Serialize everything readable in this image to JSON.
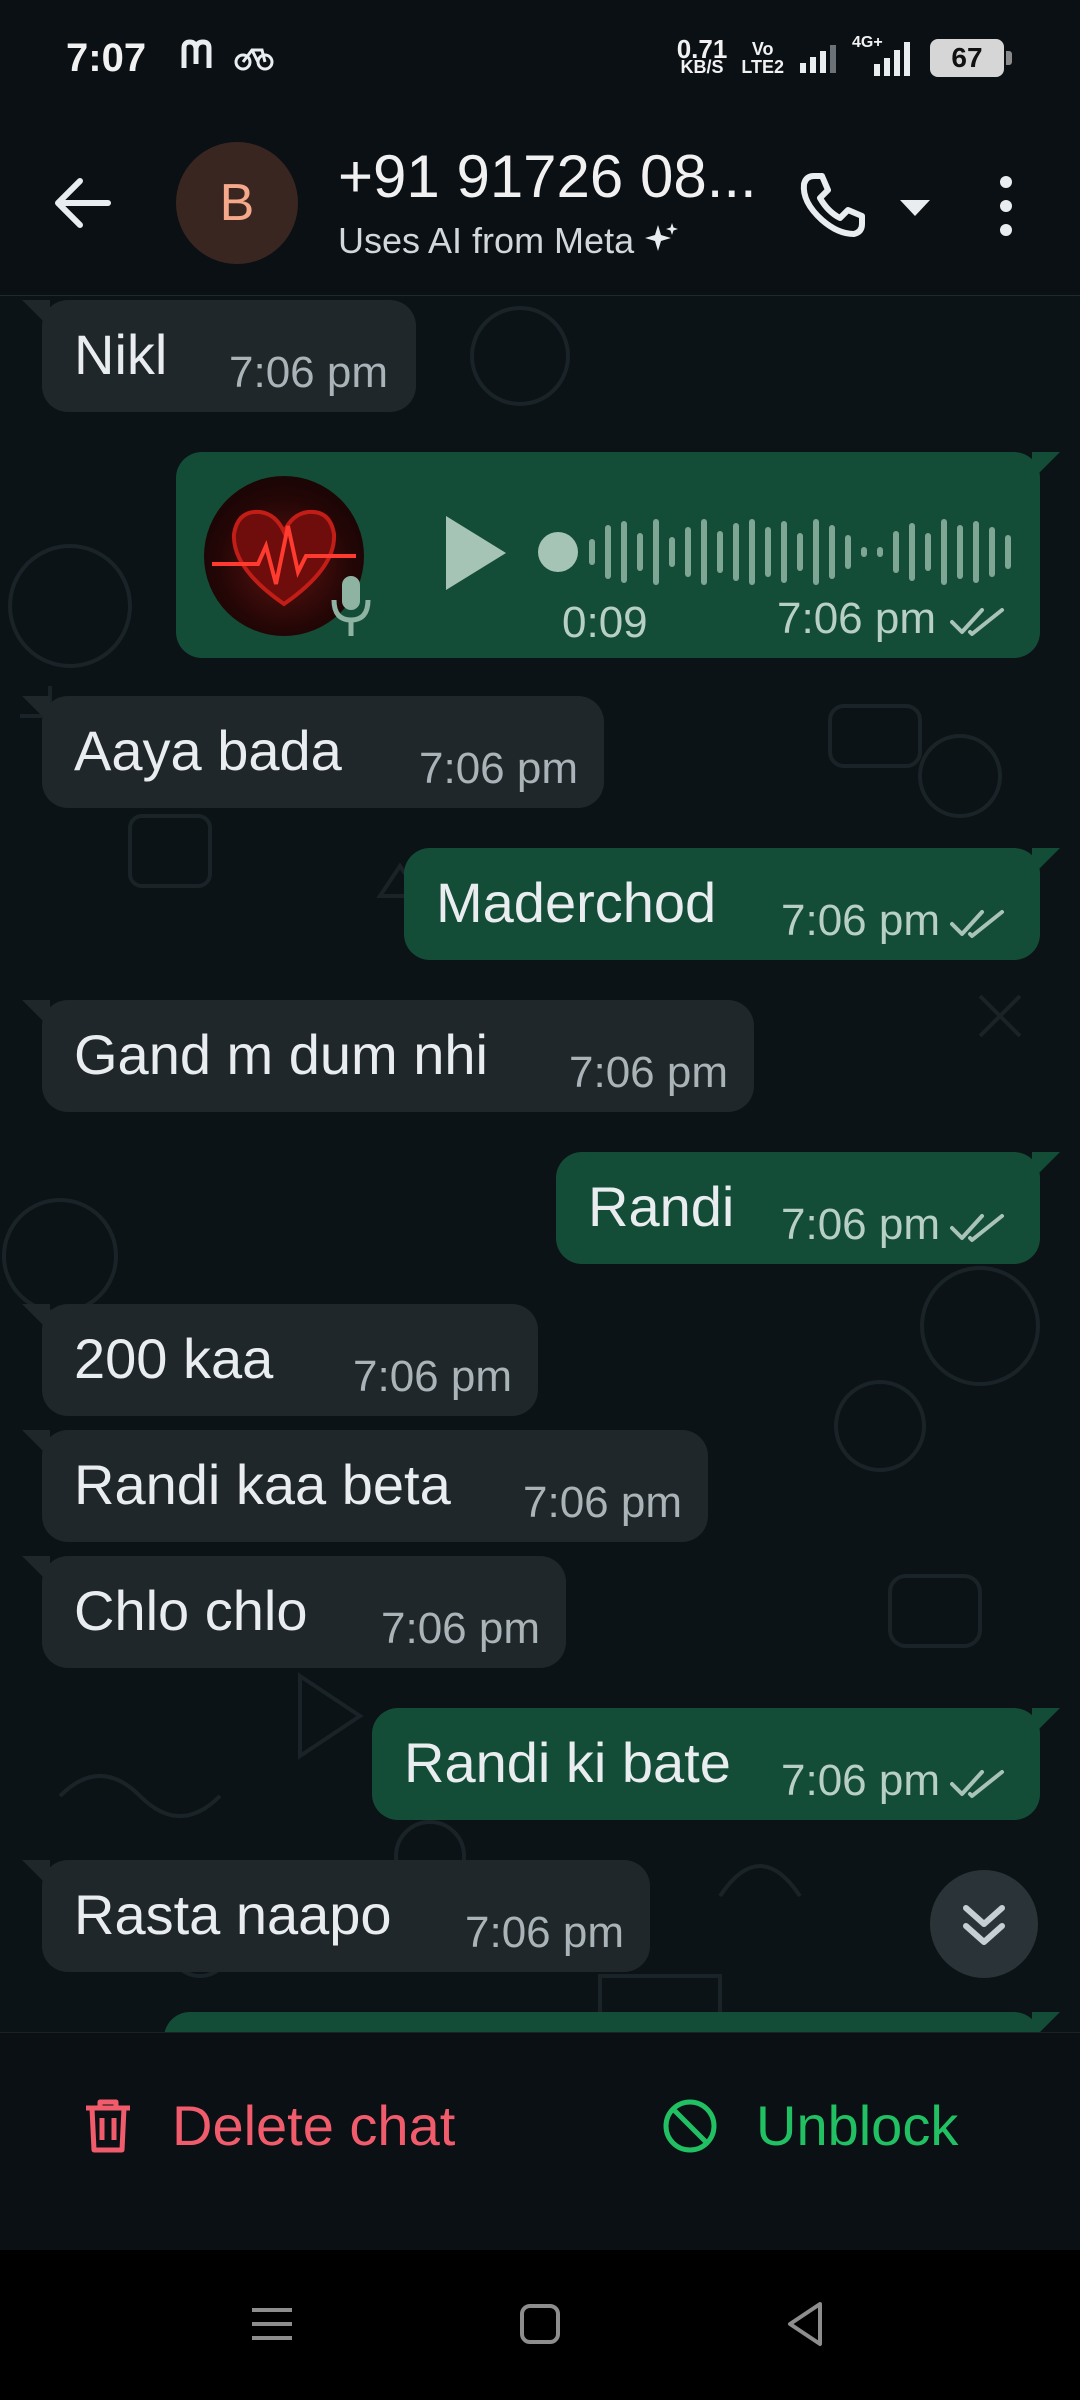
{
  "status_bar": {
    "time": "7:07",
    "net_speed_value": "0.71",
    "net_speed_unit": "KB/S",
    "volte_top": "Vo",
    "volte_bottom": "LTE2",
    "network_type": "4G+",
    "battery": "67"
  },
  "header": {
    "avatar_letter": "B",
    "contact_name": "+91 91726 08...",
    "subtitle": "Uses AI from Meta",
    "icons": [
      "back-arrow-icon",
      "phone-icon",
      "chevron-down-icon",
      "more-vert-icon"
    ]
  },
  "messages": [
    {
      "id": "m1",
      "direction": "incoming",
      "text": "Nikl",
      "time": "7:06 pm"
    },
    {
      "id": "m2",
      "direction": "outgoing",
      "type": "voice",
      "duration": "0:09",
      "time": "7:06 pm",
      "status": "read"
    },
    {
      "id": "m3",
      "direction": "incoming",
      "text": "Aaya bada",
      "time": "7:06 pm"
    },
    {
      "id": "m4",
      "direction": "outgoing",
      "text": "Maderchod",
      "time": "7:06 pm",
      "status": "read"
    },
    {
      "id": "m5",
      "direction": "incoming",
      "text": "Gand m dum nhi",
      "time": "7:06 pm"
    },
    {
      "id": "m6",
      "direction": "outgoing",
      "text": "Randi",
      "time": "7:06 pm",
      "status": "read"
    },
    {
      "id": "m7",
      "direction": "incoming",
      "text": "200 kaa",
      "time": "7:06 pm"
    },
    {
      "id": "m8",
      "direction": "incoming",
      "text": "Randi kaa beta",
      "time": "7:06 pm"
    },
    {
      "id": "m9",
      "direction": "incoming",
      "text": "Chlo chlo",
      "time": "7:06 pm"
    },
    {
      "id": "m10",
      "direction": "outgoing",
      "text": "Randi ki bate",
      "time": "7:06 pm",
      "status": "read"
    },
    {
      "id": "m11",
      "direction": "incoming",
      "text": "Rasta naapo",
      "time": "7:06 pm"
    }
  ],
  "actions": {
    "delete_label": "Delete chat",
    "unblock_label": "Unblock"
  },
  "colors": {
    "incoming_bubble": "#1f272a",
    "outgoing_bubble": "#144d37",
    "delete_red": "#f15c6d",
    "unblock_green": "#21c063"
  }
}
